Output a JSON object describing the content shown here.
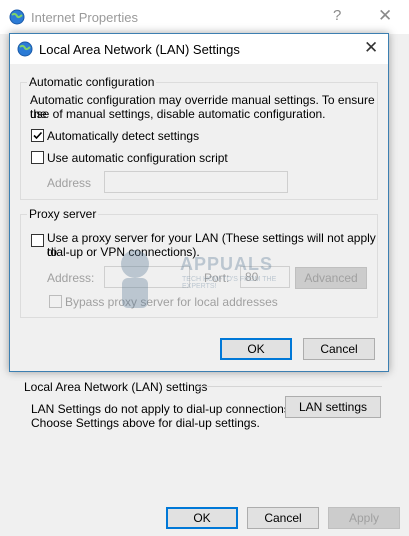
{
  "parent": {
    "title": "Internet Properties",
    "help_glyph": "?",
    "close_glyph": "✕",
    "lan_section_title": "Local Area Network (LAN) settings",
    "lan_note_line1": "LAN Settings do not apply to dial-up connections.",
    "lan_note_line2": "Choose Settings above for dial-up settings.",
    "lan_settings_button": "LAN settings",
    "ok_button": "OK",
    "cancel_button": "Cancel",
    "apply_button": "Apply"
  },
  "dialog": {
    "title": "Local Area Network (LAN) Settings",
    "close_glyph": "✕",
    "auto_config": {
      "legend": "Automatic configuration",
      "description_line1": "Automatic configuration may override manual settings.  To ensure the",
      "description_line2": "use of manual settings, disable automatic configuration.",
      "auto_detect_label": "Automatically detect settings",
      "auto_detect_checked": true,
      "use_script_label": "Use automatic configuration script",
      "use_script_checked": false,
      "address_label": "Address",
      "address_value": ""
    },
    "proxy": {
      "legend": "Proxy server",
      "use_proxy_label_line1": "Use a proxy server for your LAN (These settings will not apply to",
      "use_proxy_label_line2": "dial-up or VPN connections).",
      "use_proxy_checked": false,
      "address_label": "Address:",
      "address_value": "",
      "port_label": "Port:",
      "port_value": "80",
      "advanced_button": "Advanced",
      "bypass_label": "Bypass proxy server for local addresses",
      "bypass_checked": false
    },
    "ok_button": "OK",
    "cancel_button": "Cancel"
  },
  "watermark": {
    "brand": "APPUALS",
    "tagline": "TECH HOW-TO'S FROM THE EXPERTS!"
  },
  "colors": {
    "accent": "#0078d7",
    "window_bg": "#f0f0f0",
    "titlebar_bg": "#ffffff",
    "disabled_text": "#a0a0a0"
  }
}
